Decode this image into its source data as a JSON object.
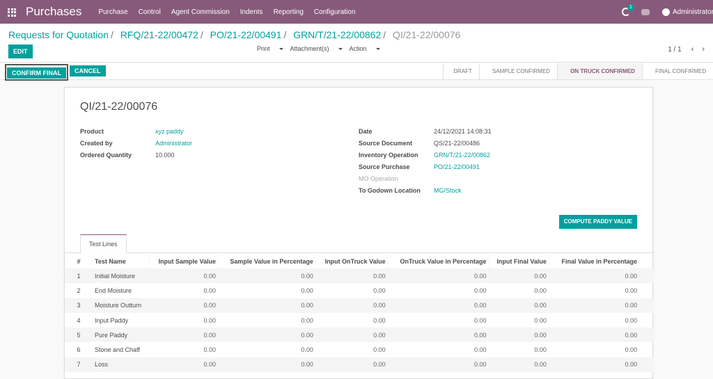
{
  "navbar": {
    "app_title": "Purchases",
    "menu": [
      "Purchase",
      "Control",
      "Agent Commission",
      "Indents",
      "Reporting",
      "Configuration"
    ],
    "activity_count": "1",
    "user_name": "Administrator",
    "bg_color": "#875a7b"
  },
  "breadcrumb": [
    {
      "label": "Requests for Quotation"
    },
    {
      "label": "RFQ/21-22/00472"
    },
    {
      "label": "PO/21-22/00491"
    },
    {
      "label": "GRN/T/21-22/00862"
    }
  ],
  "breadcrumb_current": "QI/21-22/00076",
  "breadcrumb_sep": "/",
  "toolbar": {
    "edit_label": "EDIT",
    "print_label": "Print",
    "attachments_label": "Attachment(s)",
    "action_label": "Action",
    "pager_value": "1 / 1",
    "prev_icon": "‹",
    "next_icon": "›"
  },
  "statusbar": {
    "confirm_final_label": "CONFIRM FINAL",
    "cancel_label": "CANCEL",
    "stages": [
      "DRAFT",
      "SAMPLE CONFIRMED",
      "ON TRUCK CONFIRMED",
      "FINAL CONFIRMED"
    ],
    "active_stage": "ON TRUCK CONFIRMED"
  },
  "record": {
    "title": "QI/21-22/00076",
    "left_fields": [
      {
        "label": "Product",
        "value": "xyz paddy"
      },
      {
        "label": "Created by",
        "value": "Administrator"
      },
      {
        "label": "Ordered Quantity",
        "value": "10.000"
      }
    ],
    "right_fields": [
      {
        "label": "Date",
        "value": "24/12/2021 14:08:31"
      },
      {
        "label": "Source Document",
        "value": "QS/21-22/00486"
      },
      {
        "label": "Inventory Operation",
        "value": "GRN/T/21-22/00862"
      },
      {
        "label": "Source Purchase",
        "value": "PO/21-22/00491"
      },
      {
        "label": "MO Operation",
        "value": ""
      },
      {
        "label": "To Godown Location",
        "value": "MG/Stock"
      }
    ],
    "compute_label": "COMPUTE PADDY VALUE"
  },
  "tabs": [
    {
      "label": "Test Lines"
    }
  ],
  "table": {
    "columns": [
      "#",
      "Test Name",
      "Input Sample Value",
      "Sample Value in Percentage",
      "Input OnTruck Value",
      "OnTruck Value in Percentage",
      "Input Final Value",
      "Final Value in Percentage"
    ],
    "rows": [
      [
        "1",
        "Initial Moisture",
        "0.00",
        "0.00",
        "0.00",
        "0.00",
        "0.00",
        "0.00"
      ],
      [
        "2",
        "End Moisture",
        "0.00",
        "0.00",
        "0.00",
        "0.00",
        "0.00",
        "0.00"
      ],
      [
        "3",
        "Moisture Outturn",
        "0.00",
        "0.00",
        "0.00",
        "0.00",
        "0.00",
        "0.00"
      ],
      [
        "4",
        "Input Paddy",
        "0.00",
        "0.00",
        "0.00",
        "0.00",
        "0.00",
        "0.00"
      ],
      [
        "5",
        "Pure Paddy",
        "0.00",
        "0.00",
        "0.00",
        "0.00",
        "0.00",
        "0.00"
      ],
      [
        "6",
        "Stone and Chaff",
        "0.00",
        "0.00",
        "0.00",
        "0.00",
        "0.00",
        "0.00"
      ],
      [
        "7",
        "Loss",
        "0.00",
        "0.00",
        "0.00",
        "0.00",
        "0.00",
        "0.00"
      ]
    ]
  },
  "colors": {
    "accent": "#00a09d",
    "brand": "#875a7b"
  }
}
